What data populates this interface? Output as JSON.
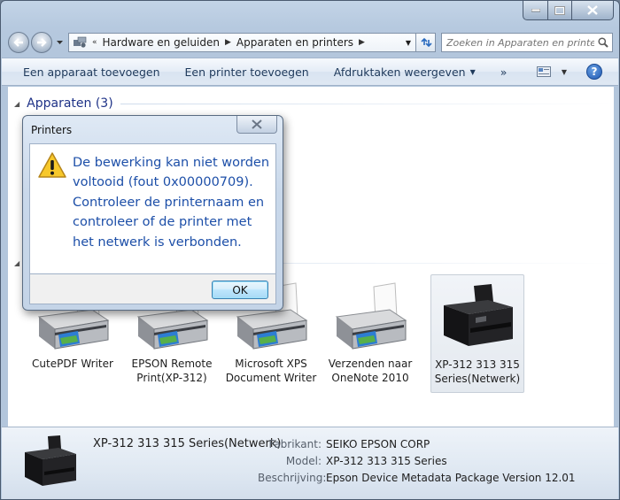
{
  "window": {
    "caption": {
      "minimize": "−",
      "maximize": "□",
      "close": "✕"
    }
  },
  "nav": {
    "breadcrumb_prefix": "«",
    "breadcrumb": [
      "Hardware en geluiden",
      "Apparaten en printers"
    ],
    "search_placeholder": "Zoeken in Apparaten en printe..."
  },
  "commandbar": {
    "add_device": "Een apparaat toevoegen",
    "add_printer": "Een printer toevoegen",
    "print_jobs": "Afdruktaken weergeven",
    "more": "»",
    "help": "?"
  },
  "groups": {
    "devices": "Apparaten (3)"
  },
  "printers": [
    {
      "label": "CutePDF Writer",
      "selected": false
    },
    {
      "label": "EPSON Remote Print(XP-312)",
      "selected": false
    },
    {
      "label": "Microsoft XPS Document Writer",
      "selected": false
    },
    {
      "label": "Verzenden naar OneNote 2010",
      "selected": false
    },
    {
      "label": "XP-312 313 315 Series(Netwerk)",
      "selected": true
    }
  ],
  "details": {
    "name": "XP-312 313 315 Series(Netwerk)",
    "rows": [
      {
        "key": "Fabrikant:",
        "value": "SEIKO EPSON CORP"
      },
      {
        "key": "Model:",
        "value": "XP-312 313 315 Series"
      },
      {
        "key": "Beschrijving:",
        "value": "Epson Device Metadata Package Version 12.01"
      }
    ]
  },
  "dialog": {
    "title": "Printers",
    "message": "De bewerking kan niet worden voltooid (fout 0x00000709). Controleer de printernaam en controleer of de printer met het netwerk is verbonden.",
    "ok": "OK"
  },
  "colors": {
    "accent": "#1e3287",
    "dialog_text": "#1d4fa8",
    "command_text": "#1e395b"
  }
}
